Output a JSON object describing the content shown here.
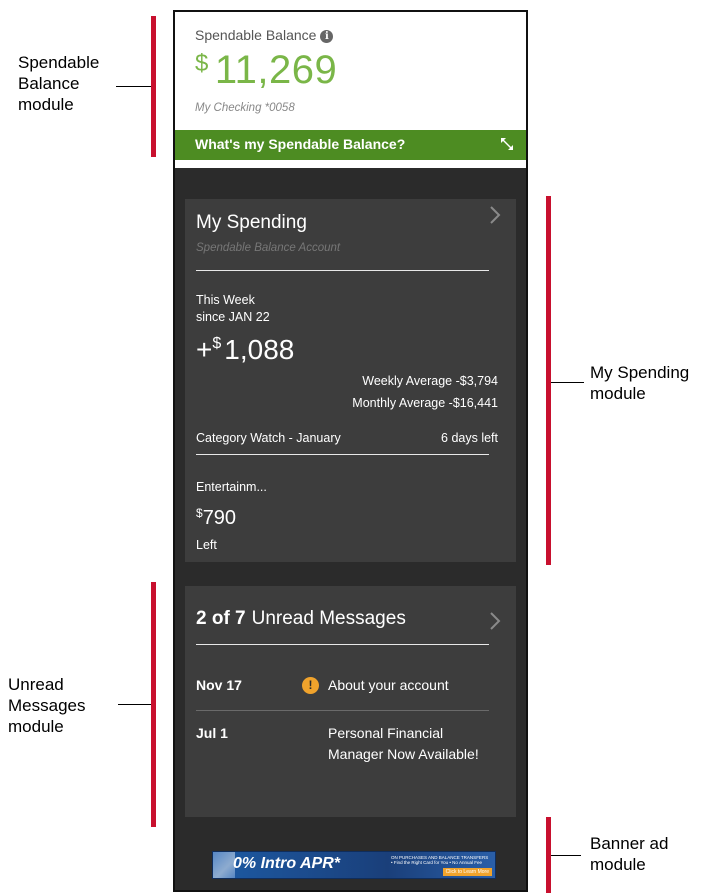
{
  "annotations": {
    "spendable_balance": "Spendable\nBalance\nmodule",
    "my_spending": "My Spending\nmodule",
    "unread_messages": "Unread\nMessages\nmodule",
    "banner_ad": "Banner ad\nmodule"
  },
  "spendable_balance": {
    "title": "Spendable Balance",
    "currency": "$",
    "amount": "11,269",
    "account": "My Checking *0058",
    "link_label": "What's my Spendable Balance?"
  },
  "my_spending": {
    "title": "My Spending",
    "subtitle": "Spendable Balance Account",
    "period": "This Week",
    "since": "since JAN 22",
    "sign": "+",
    "currency": "$",
    "amount": "1,088",
    "weekly_average": "Weekly Average -$3,794",
    "monthly_average": "Monthly Average -$16,441",
    "category_watch": "Category Watch - January",
    "days_left": "6 days left",
    "category": "Entertainm...",
    "category_currency": "$",
    "category_amount": "790",
    "category_left": "Left"
  },
  "unread_messages": {
    "count": "2 of 7",
    "title": "Unread Messages",
    "messages": [
      {
        "date": "Nov 17",
        "subject": "About your account",
        "alert": "!"
      },
      {
        "date": "Jul 1",
        "subject": "Personal Financial Manager Now Available!"
      }
    ]
  },
  "banner_ad": {
    "headline": "0% Intro APR*",
    "detail": "ON PURCHASES AND BALANCE TRANSFERS",
    "fine_print": "• Find the Right Card for You • No Annual Fee",
    "cta": "Click to Learn More"
  },
  "colors": {
    "accent_green": "#7ab648",
    "link_bar_green": "#4d8c22",
    "annotation_red": "#c8102e",
    "alert_orange": "#f0a32c",
    "panel_dark": "#2b2b2b",
    "card_dark": "#3d3d3d"
  },
  "icons": {
    "info": "info-icon",
    "expand": "expand-icon",
    "chevron": "chevron-right-icon",
    "alert": "alert-icon"
  }
}
